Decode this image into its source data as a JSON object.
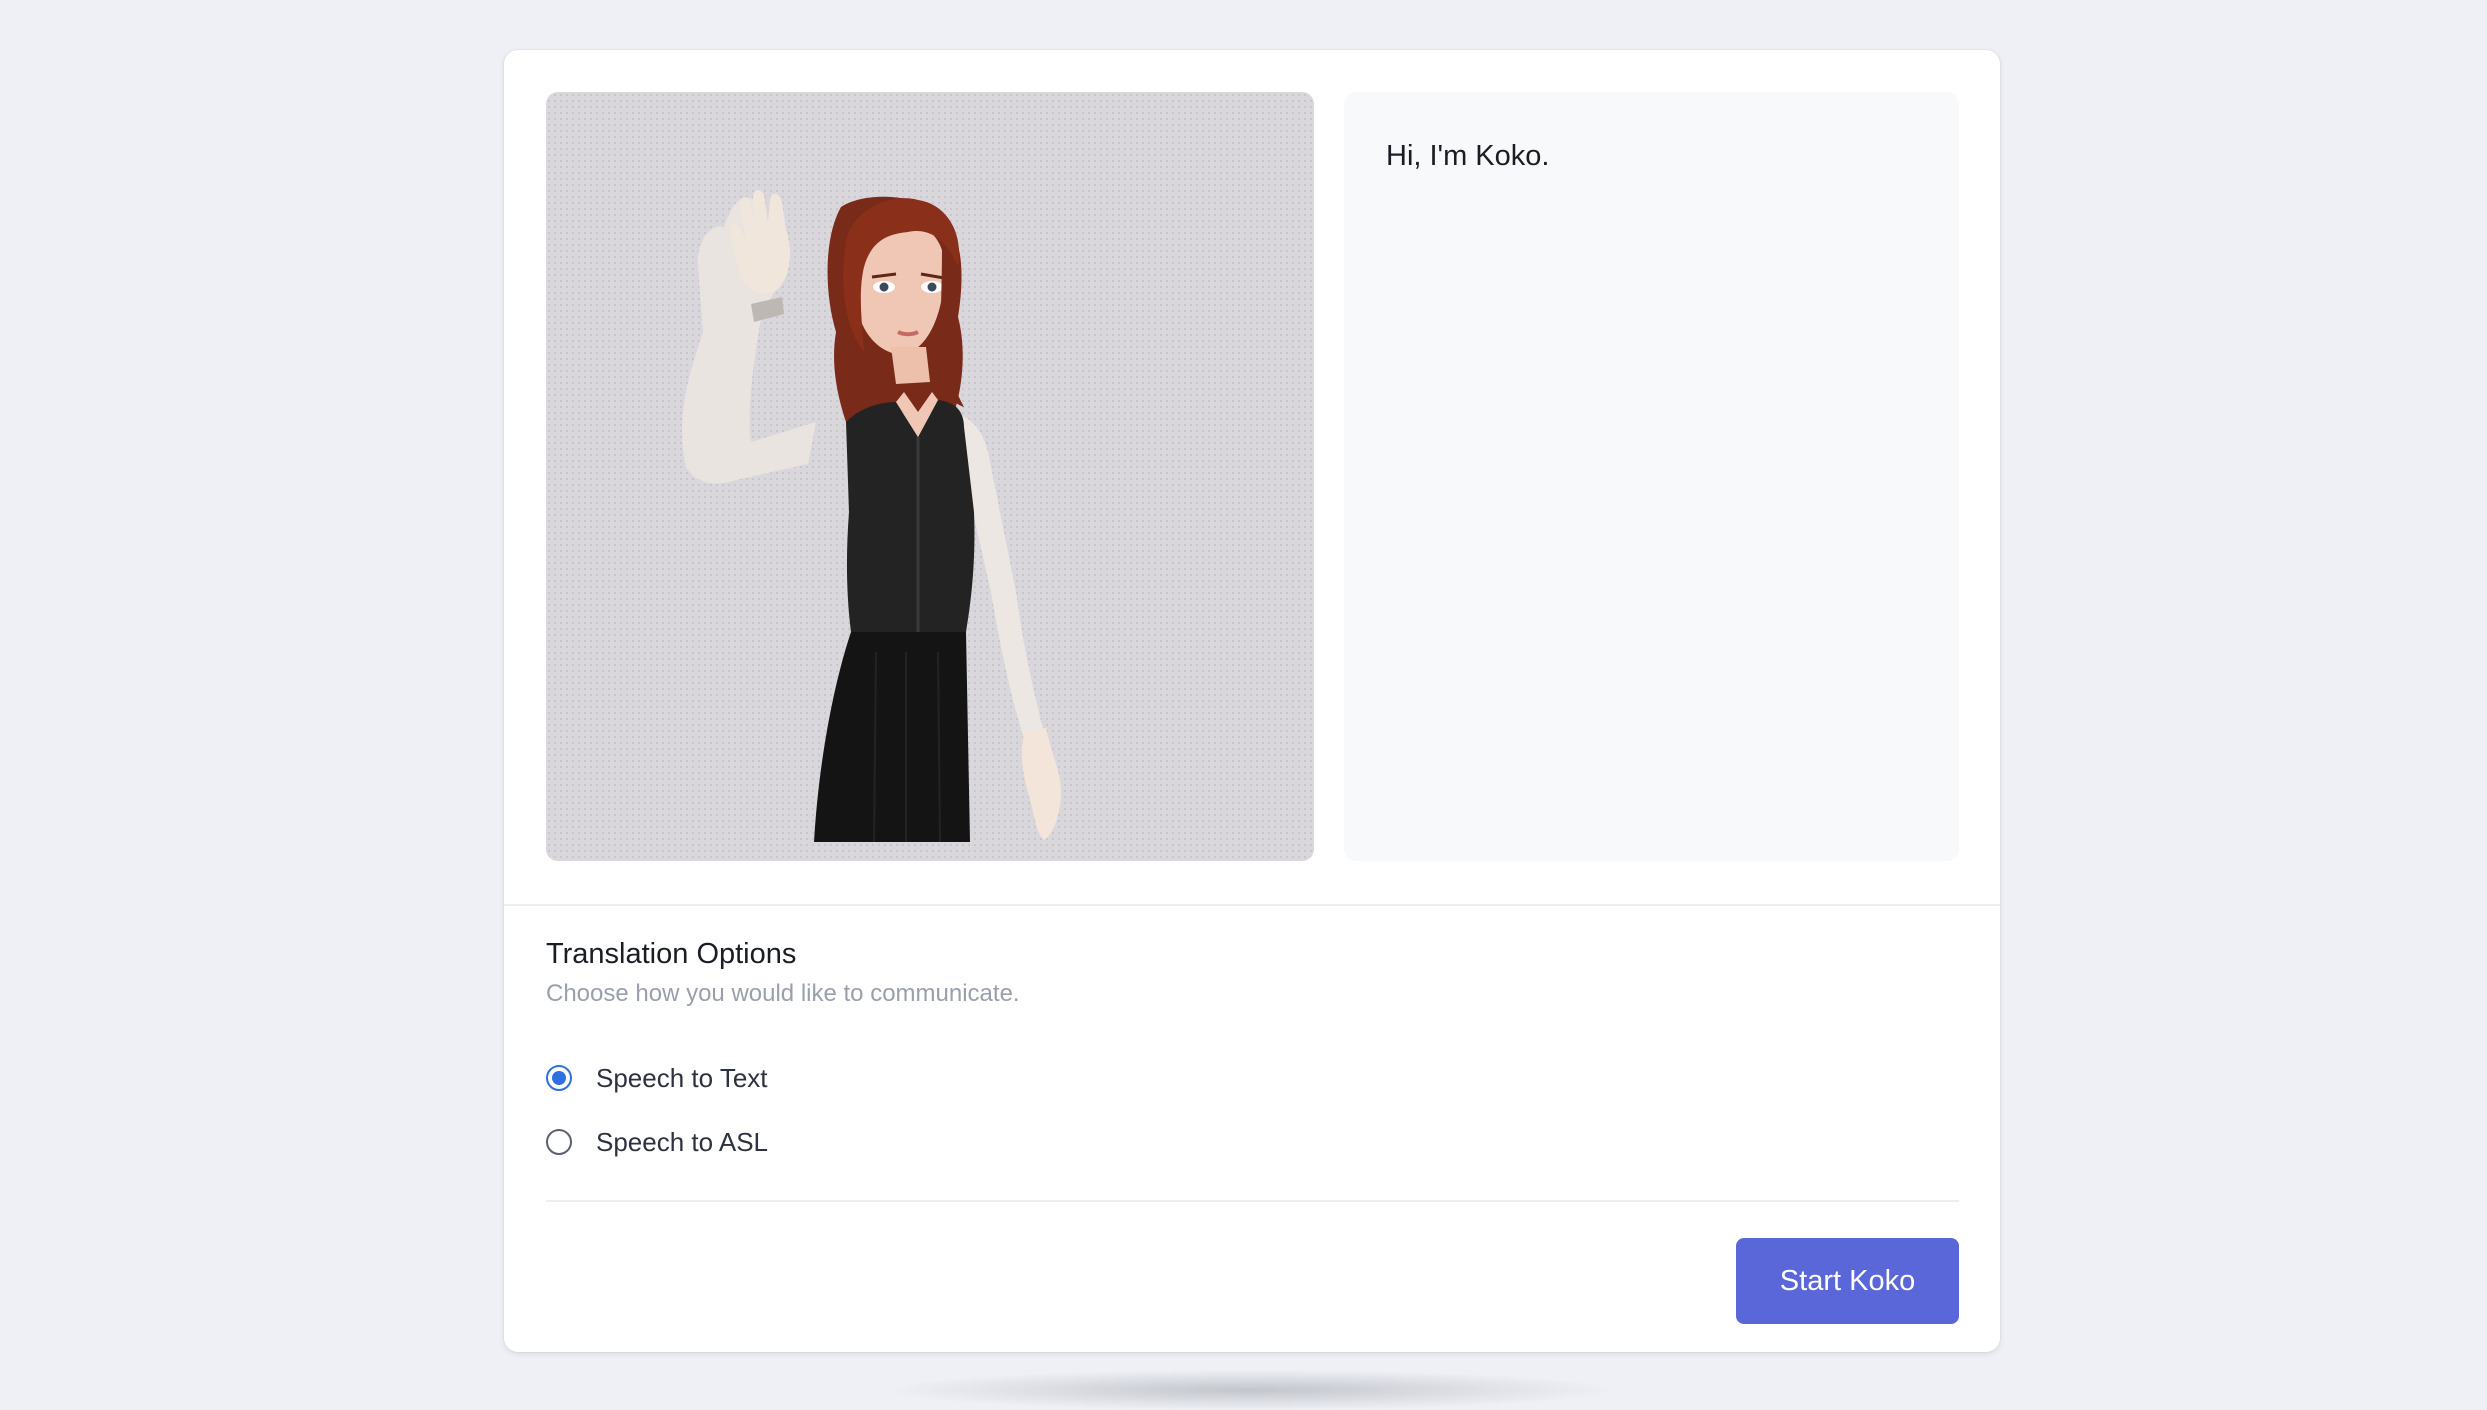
{
  "transcript": {
    "greeting": "Hi, I'm Koko."
  },
  "avatar": {
    "description_icon": "signing-avatar-icon"
  },
  "translation_options": {
    "title": "Translation Options",
    "subtitle": "Choose how you would like to communicate.",
    "options": [
      {
        "label": "Speech to Text",
        "selected": true
      },
      {
        "label": "Speech to ASL",
        "selected": false
      }
    ]
  },
  "actions": {
    "start_label": "Start Koko"
  },
  "colors": {
    "accent": "#5a67d8",
    "radio_selected": "#2f6fe0",
    "page_background": "#eef0f5"
  }
}
